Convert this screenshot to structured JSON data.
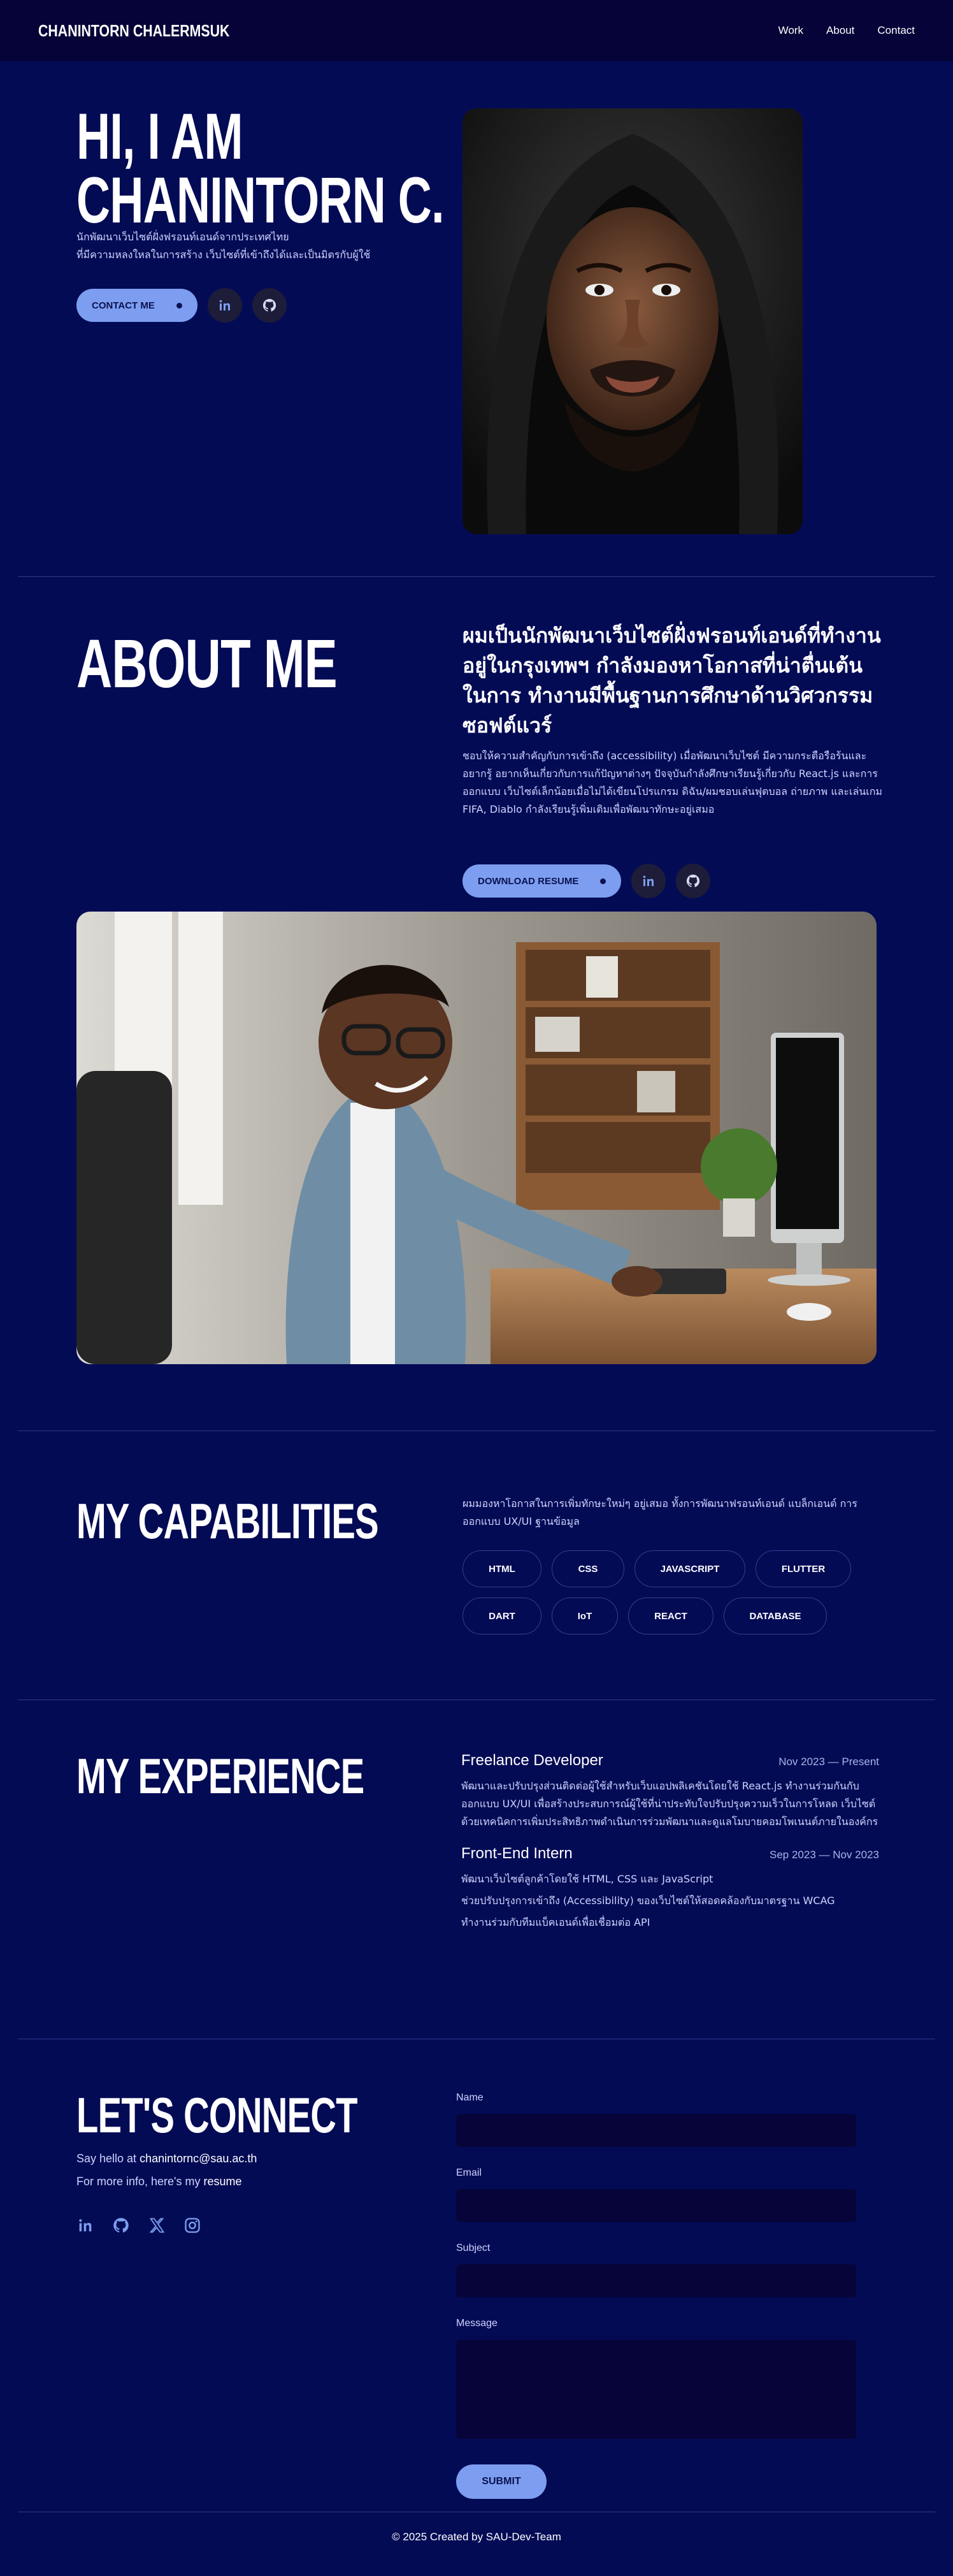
{
  "header": {
    "brand": "CHANINTORN CHALERMSUK",
    "nav": [
      "Work",
      "About",
      "Contact"
    ]
  },
  "hero": {
    "title_line1": "HI, I AM",
    "title_line2": "CHANINTORN C.",
    "subtitle_line1": "นักพัฒนาเว็บไซต์ฝั่งฟรอนท์เอนด์จากประเทศไทย",
    "subtitle_line2": "ที่มีความหลงใหลในการสร้าง เว็บไซต์ที่เข้าถึงได้และเป็นมิตรกับผู้ใช้",
    "cta_label": "CONTACT ME"
  },
  "about": {
    "title": "ABOUT ME",
    "headline": "ผมเป็นนักพัฒนาเว็บไซต์ฝั่งฟรอนท์เอนด์ที่ทำงานอยู่ในกรุงเทพฯ กำลังมองหาโอกาสที่น่าตื่นเต้นในการ ทำงานมีพื้นฐานการศึกษาด้านวิศวกรรมซอฟต์แวร์",
    "body": "ชอบให้ความสำคัญกับการเข้าถึง (accessibility) เมื่อพัฒนาเว็บไซต์ มีความกระตือรือร้นและอยากรู้ อยากเห็นเกี่ยวกับการแก้ปัญหาต่างๆ ปัจจุบันกำลังศึกษาเรียนรู้เกี่ยวกับ React.js และการออกแบบ เว็บไซต์เล็กน้อยเมื่อไม่ได้เขียนโปรแกรม ดิฉัน/ผมชอบเล่นฟุตบอล ถ่ายภาพ และเล่นเกม FIFA, Diablo กำลังเรียนรู้เพิ่มเติมเพื่อพัฒนาทักษะอยู่เสมอ",
    "cta_label": "DOWNLOAD RESUME"
  },
  "capabilities": {
    "title": "MY CAPABILITIES",
    "intro": "ผมมองหาโอกาสในการเพิ่มทักษะใหม่ๆ อยู่เสมอ ทั้งการพัฒนาฟรอนท์เอนด์ แบล็กเอนด์ การออกแบบ UX/UI ฐานข้อมูล",
    "tags": [
      "HTML",
      "CSS",
      "JAVASCRIPT",
      "FLUTTER",
      "DART",
      "IoT",
      "REACT",
      "DATABASE"
    ]
  },
  "experience": {
    "title": "MY EXPERIENCE",
    "jobs": [
      {
        "title": "Freelance Developer",
        "date": "Nov 2023 — Present",
        "desc": "พัฒนาและปรับปรุงส่วนติดต่อผู้ใช้สำหรับเว็บแอปพลิเคชันโดยใช้ React.js ทำงานร่วมกันกับ ออกแบบ UX/UI เพื่อสร้างประสบการณ์ผู้ใช้ที่น่าประทับใจปรับปรุงความเร็วในการโหลด เว็บไซต์ด้วยเทคนิคการเพิ่มประสิทธิภาพดำเนินการร่วมพัฒนาและดูแลโมบายคอมโพเนนต์ภายในองค์กร"
      },
      {
        "title": "Front-End Intern",
        "date": "Sep 2023 — Nov 2023",
        "lines": [
          "พัฒนาเว็บไซต์ลูกค้าโดยใช้ HTML, CSS และ JavaScript",
          "ช่วยปรับปรุงการเข้าถึง (Accessibility) ของเว็บไซต์ให้สอดคล้องกับมาตรฐาน WCAG",
          "ทำงานร่วมกับทีมแบ็คเอนด์เพื่อเชื่อมต่อ API"
        ]
      }
    ]
  },
  "connect": {
    "title": "LET'S CONNECT",
    "say_hello_prefix": "Say hello at ",
    "email": "chanintornc@sau.ac.th",
    "more_info_prefix": "For more info, here's my ",
    "resume_link": "resume",
    "form": {
      "name_label": "Name",
      "email_label": "Email",
      "subject_label": "Subject",
      "message_label": "Message",
      "submit_label": "SUBMIT"
    }
  },
  "footer": {
    "text": "© 2025 Created by SAU-Dev-Team"
  },
  "colors": {
    "background": "#040b55",
    "header": "#050337",
    "accent": "#7d9ef0",
    "input": "#07043a"
  }
}
